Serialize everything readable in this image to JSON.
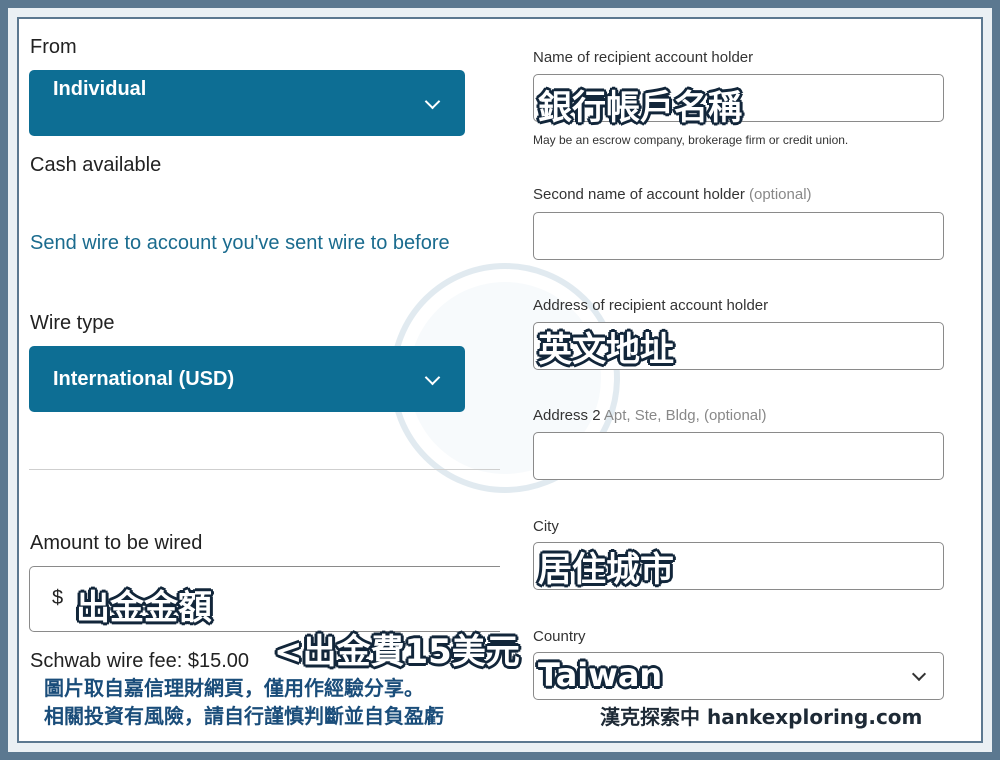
{
  "left": {
    "from_label": "From",
    "from_value": "Individual",
    "cash_label": "Cash available",
    "send_link": "Send wire to account you've sent wire to before",
    "wire_type_label": "Wire type",
    "wire_type_value": "International (USD)",
    "amount_label": "Amount to be wired",
    "currency_symbol": "$",
    "fee_text": "Schwab wire fee: $15.00"
  },
  "right": {
    "name_label": "Name of recipient account holder",
    "name_hint": "May be an escrow company, brokerage firm or credit union.",
    "second_name_label": "Second name of account holder",
    "second_name_optional": "(optional)",
    "address_label": "Address of recipient account holder",
    "address2_label": "Address 2",
    "address2_hint": "Apt, Ste, Bldg, (optional)",
    "city_label": "City",
    "country_label": "Country",
    "country_value": "Taiwan"
  },
  "annotations": {
    "name": "銀行帳戶名稱",
    "address": "英文地址",
    "city": "居住城市",
    "amount": "出金金額",
    "fee": "<出金費15美元",
    "country": "Taiwan"
  },
  "footer": {
    "disclaimer_line1": "圖片取自嘉信理財網頁，僅用作經驗分享。",
    "disclaimer_line2": "相關投資有風險，請自行謹慎判斷並自負盈虧",
    "brand": "漢克探索中 hankexploring.com"
  },
  "colors": {
    "accent": "#0d6e94",
    "frame": "#5b7890",
    "link": "#1a6b8e"
  }
}
